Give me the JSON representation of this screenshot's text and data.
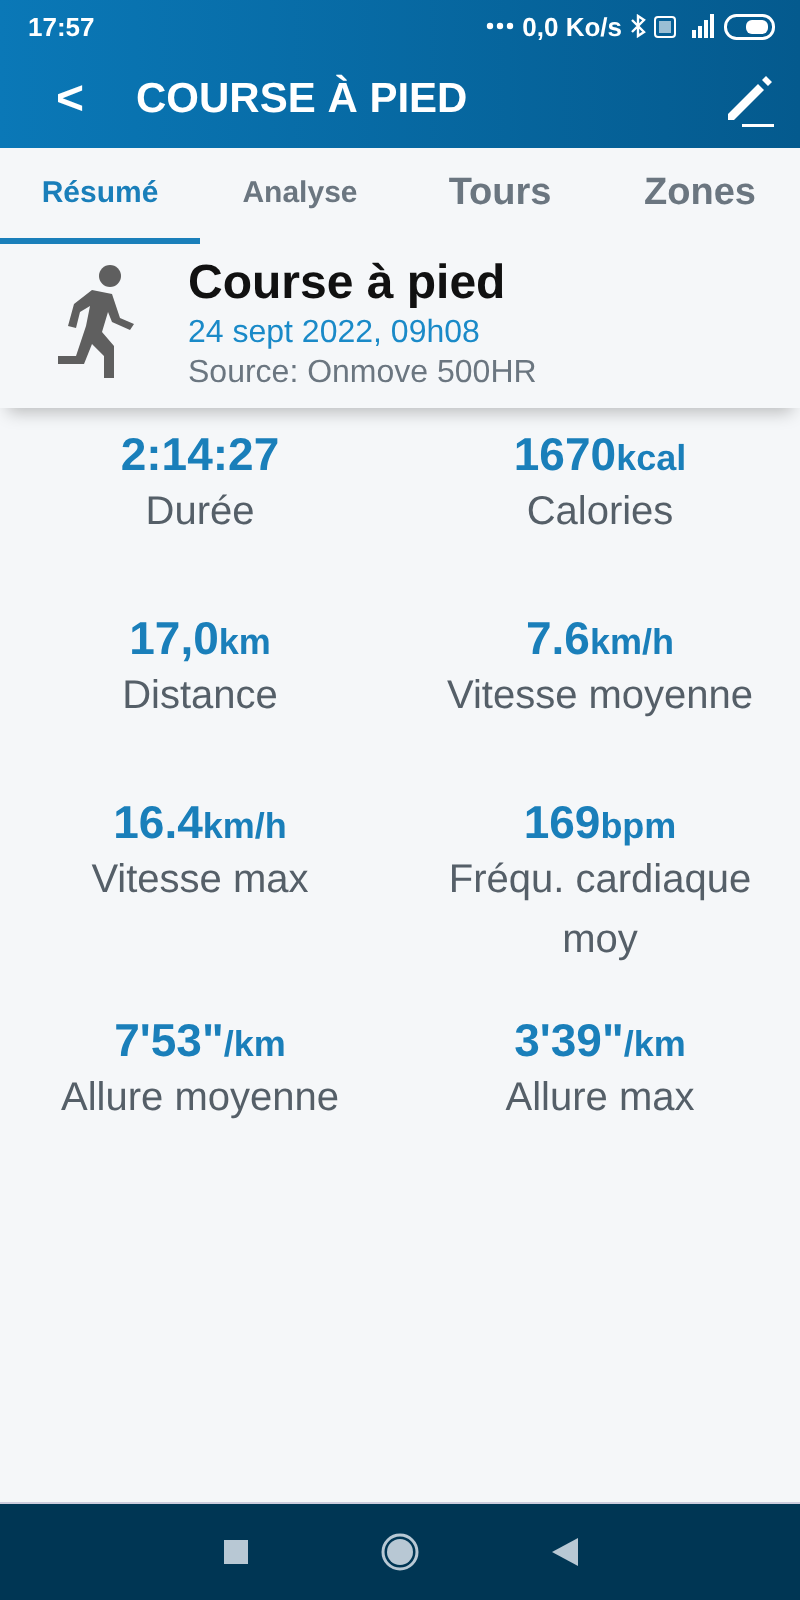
{
  "status_bar": {
    "time": "17:57",
    "network_speed": "0,0 Ko/s"
  },
  "header": {
    "back": "<",
    "title": "COURSE À PIED"
  },
  "tabs": [
    {
      "label": "Résumé",
      "selected": true
    },
    {
      "label": "Analyse",
      "selected": false
    },
    {
      "label": "Tours",
      "selected": false
    },
    {
      "label": "Zones",
      "selected": false
    }
  ],
  "activity": {
    "name": "Course à pied",
    "date": "24 sept 2022, 09h08",
    "source": "Source: Onmove 500HR"
  },
  "stats": [
    {
      "value": "2:14:27",
      "label": "Durée"
    },
    {
      "value": "1670",
      "unit": "kcal",
      "label": "Calories"
    },
    {
      "value": "17,0",
      "unit": "km",
      "label": "Distance"
    },
    {
      "value": "7.6",
      "unit": "km/h",
      "label": "Vitesse moyenne"
    },
    {
      "value": "16.4",
      "unit": "km/h",
      "label": "Vitesse max"
    },
    {
      "value": "169",
      "unit": "bpm",
      "label": "Fréqu. cardiaque moy"
    },
    {
      "value": "7'53\"",
      "unit": "/km",
      "label": "Allure moyenne"
    },
    {
      "value": "3'39\"",
      "unit": "/km",
      "label": "Allure max"
    }
  ]
}
